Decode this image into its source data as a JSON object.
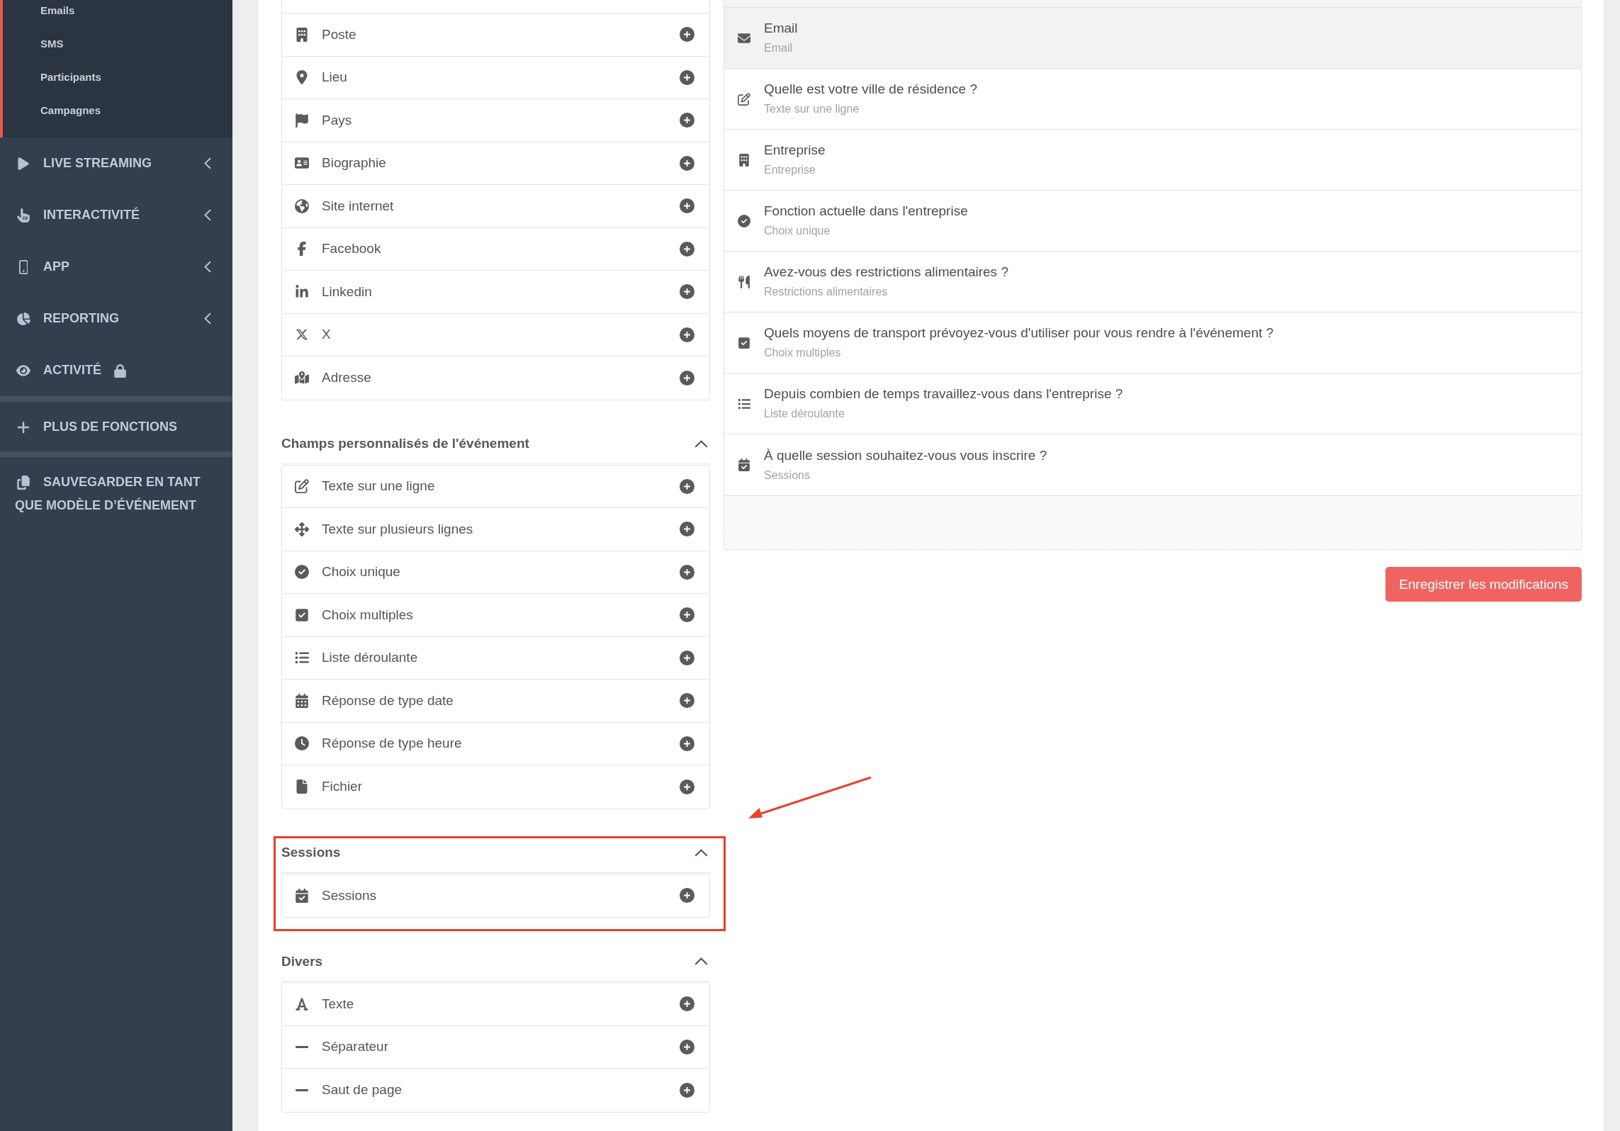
{
  "sidebar": {
    "sub_items": [
      "Emails",
      "SMS",
      "Participants",
      "Campagnes"
    ],
    "groups": [
      {
        "items": [
          {
            "label": "LIVE STREAMING",
            "kind": "streaming",
            "submenu": true,
            "locked": false
          },
          {
            "label": "INTERACTIVITÉ",
            "kind": "interactivity",
            "submenu": true,
            "locked": false
          },
          {
            "label": "APP",
            "kind": "app",
            "submenu": true,
            "locked": false
          },
          {
            "label": "REPORTING",
            "kind": "reporting",
            "submenu": true,
            "locked": false
          },
          {
            "label": "ACTIVITÉ",
            "kind": "activity",
            "submenu": false,
            "locked": true
          }
        ]
      },
      {
        "items": [
          {
            "label": "PLUS DE FONCTIONS",
            "kind": "more",
            "submenu": false,
            "locked": false
          }
        ]
      },
      {
        "items": [
          {
            "label": "SAUVEGARDER EN TANT QUE MODÈLE D’ÉVÉNEMENT",
            "kind": "template",
            "submenu": false,
            "locked": false
          }
        ]
      }
    ]
  },
  "field_sections": [
    {
      "expanded": true,
      "highlighted": false,
      "items": [
        {
          "label": "Poste",
          "kind": "position"
        },
        {
          "label": "Lieu",
          "kind": "location"
        },
        {
          "label": "Pays",
          "kind": "country"
        },
        {
          "label": "Biographie",
          "kind": "biography"
        },
        {
          "label": "Site internet",
          "kind": "website"
        },
        {
          "label": "Facebook",
          "kind": "facebook"
        },
        {
          "label": "Linkedin",
          "kind": "linkedin"
        },
        {
          "label": "X",
          "kind": "x"
        },
        {
          "label": "Adresse",
          "kind": "address"
        }
      ]
    },
    {
      "title": "Champs personnalisés de l'événement",
      "expanded": true,
      "highlighted": false,
      "items": [
        {
          "label": "Texte sur une ligne",
          "kind": "textline"
        },
        {
          "label": "Texte sur plusieurs lignes",
          "kind": "textarea"
        },
        {
          "label": "Choix unique",
          "kind": "single"
        },
        {
          "label": "Choix multiples",
          "kind": "multiple"
        },
        {
          "label": "Liste déroulante",
          "kind": "dropdown"
        },
        {
          "label": "Réponse de type date",
          "kind": "date"
        },
        {
          "label": "Réponse de type heure",
          "kind": "time"
        },
        {
          "label": "Fichier",
          "kind": "file"
        }
      ]
    },
    {
      "title": "Sessions",
      "expanded": true,
      "highlighted": true,
      "items": [
        {
          "label": "Sessions",
          "kind": "sessions"
        }
      ]
    },
    {
      "title": "Divers",
      "expanded": true,
      "highlighted": false,
      "items": [
        {
          "label": "Texte",
          "kind": "text"
        },
        {
          "label": "Séparateur",
          "kind": "separator"
        },
        {
          "label": "Saut de page",
          "kind": "pagebreak"
        }
      ]
    }
  ],
  "form_fields": [
    {
      "label": "Email",
      "type": "Email",
      "kind": "email",
      "selected": true
    },
    {
      "label": "Quelle est votre ville de résidence ?",
      "type": "Texte sur une ligne",
      "kind": "textline",
      "selected": false
    },
    {
      "label": "Entreprise",
      "type": "Entreprise",
      "kind": "company",
      "selected": false
    },
    {
      "label": "Fonction actuelle dans l'entreprise",
      "type": "Choix unique",
      "kind": "single",
      "selected": false
    },
    {
      "label": "Avez-vous des restrictions alimentaires ?",
      "type": "Restrictions alimentaires",
      "kind": "diet",
      "selected": false
    },
    {
      "label": "Quels moyens de transport prévoyez-vous d'utiliser pour vous rendre à l'événement ?",
      "type": "Choix multiples",
      "kind": "multiple",
      "selected": false
    },
    {
      "label": "Depuis combien de temps travaillez-vous dans l'entreprise ?",
      "type": "Liste déroulante",
      "kind": "dropdown",
      "selected": false
    },
    {
      "label": "À quelle session souhaitez-vous vous inscrire ?",
      "type": "Sessions",
      "kind": "sessions",
      "selected": false
    }
  ],
  "save_button": {
    "label": "Enregistrer les modifications"
  }
}
